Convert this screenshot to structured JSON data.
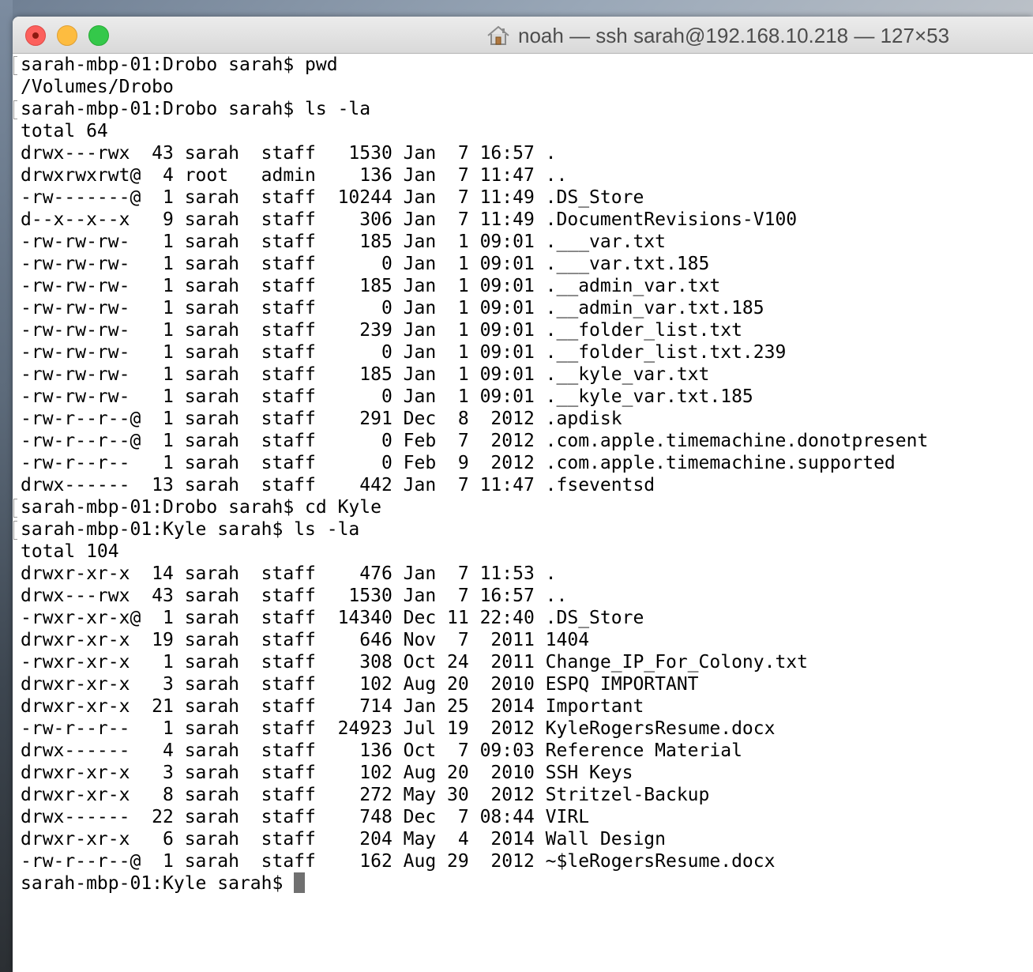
{
  "window": {
    "title": "noah — ssh sarah@192.168.10.218 — 127×53",
    "title_icon": "home-icon"
  },
  "terminal": {
    "lines": [
      {
        "text": "sarah-mbp-01:Drobo sarah$ pwd",
        "kind": "cmd"
      },
      {
        "text": "/Volumes/Drobo",
        "kind": "out"
      },
      {
        "text": "sarah-mbp-01:Drobo sarah$ ls -la",
        "kind": "cmd"
      },
      {
        "text": "total 64",
        "kind": "out"
      },
      {
        "text": "drwx---rwx  43 sarah  staff   1530 Jan  7 16:57 .",
        "kind": "out"
      },
      {
        "text": "drwxrwxrwt@  4 root   admin    136 Jan  7 11:47 ..",
        "kind": "out"
      },
      {
        "text": "-rw-------@  1 sarah  staff  10244 Jan  7 11:49 .DS_Store",
        "kind": "out"
      },
      {
        "text": "d--x--x--x   9 sarah  staff    306 Jan  7 11:49 .DocumentRevisions-V100",
        "kind": "out"
      },
      {
        "text": "-rw-rw-rw-   1 sarah  staff    185 Jan  1 09:01 .___var.txt",
        "kind": "out"
      },
      {
        "text": "-rw-rw-rw-   1 sarah  staff      0 Jan  1 09:01 .___var.txt.185",
        "kind": "out"
      },
      {
        "text": "-rw-rw-rw-   1 sarah  staff    185 Jan  1 09:01 .__admin_var.txt",
        "kind": "out"
      },
      {
        "text": "-rw-rw-rw-   1 sarah  staff      0 Jan  1 09:01 .__admin_var.txt.185",
        "kind": "out"
      },
      {
        "text": "-rw-rw-rw-   1 sarah  staff    239 Jan  1 09:01 .__folder_list.txt",
        "kind": "out"
      },
      {
        "text": "-rw-rw-rw-   1 sarah  staff      0 Jan  1 09:01 .__folder_list.txt.239",
        "kind": "out"
      },
      {
        "text": "-rw-rw-rw-   1 sarah  staff    185 Jan  1 09:01 .__kyle_var.txt",
        "kind": "out"
      },
      {
        "text": "-rw-rw-rw-   1 sarah  staff      0 Jan  1 09:01 .__kyle_var.txt.185",
        "kind": "out"
      },
      {
        "text": "-rw-r--r--@  1 sarah  staff    291 Dec  8  2012 .apdisk",
        "kind": "out"
      },
      {
        "text": "-rw-r--r--@  1 sarah  staff      0 Feb  7  2012 .com.apple.timemachine.donotpresent",
        "kind": "out"
      },
      {
        "text": "-rw-r--r--   1 sarah  staff      0 Feb  9  2012 .com.apple.timemachine.supported",
        "kind": "out"
      },
      {
        "text": "drwx------  13 sarah  staff    442 Jan  7 11:47 .fseventsd",
        "kind": "out"
      },
      {
        "text": "sarah-mbp-01:Drobo sarah$ cd Kyle",
        "kind": "cmd"
      },
      {
        "text": "sarah-mbp-01:Kyle sarah$ ls -la",
        "kind": "cmd"
      },
      {
        "text": "total 104",
        "kind": "out"
      },
      {
        "text": "drwxr-xr-x  14 sarah  staff    476 Jan  7 11:53 .",
        "kind": "out"
      },
      {
        "text": "drwx---rwx  43 sarah  staff   1530 Jan  7 16:57 ..",
        "kind": "out"
      },
      {
        "text": "-rwxr-xr-x@  1 sarah  staff  14340 Dec 11 22:40 .DS_Store",
        "kind": "out"
      },
      {
        "text": "drwxr-xr-x  19 sarah  staff    646 Nov  7  2011 1404",
        "kind": "out"
      },
      {
        "text": "-rwxr-xr-x   1 sarah  staff    308 Oct 24  2011 Change_IP_For_Colony.txt",
        "kind": "out"
      },
      {
        "text": "drwxr-xr-x   3 sarah  staff    102 Aug 20  2010 ESPQ IMPORTANT",
        "kind": "out"
      },
      {
        "text": "drwxr-xr-x  21 sarah  staff    714 Jan 25  2014 Important",
        "kind": "out"
      },
      {
        "text": "-rw-r--r--   1 sarah  staff  24923 Jul 19  2012 KyleRogersResume.docx",
        "kind": "out"
      },
      {
        "text": "drwx------   4 sarah  staff    136 Oct  7 09:03 Reference Material",
        "kind": "out"
      },
      {
        "text": "drwxr-xr-x   3 sarah  staff    102 Aug 20  2010 SSH Keys",
        "kind": "out"
      },
      {
        "text": "drwxr-xr-x   8 sarah  staff    272 May 30  2012 Stritzel-Backup",
        "kind": "out"
      },
      {
        "text": "drwx------  22 sarah  staff    748 Dec  7 08:44 VIRL",
        "kind": "out"
      },
      {
        "text": "drwxr-xr-x   6 sarah  staff    204 May  4  2014 Wall Design",
        "kind": "out"
      },
      {
        "text": "-rw-r--r--@  1 sarah  staff    162 Aug 29  2012 ~$leRogersResume.docx",
        "kind": "out"
      }
    ],
    "prompt": "sarah-mbp-01:Kyle sarah$ "
  },
  "colors": {
    "close": "#fc605c",
    "minimize": "#fdbc40",
    "maximize": "#34c84a",
    "cursor": "#707070"
  }
}
